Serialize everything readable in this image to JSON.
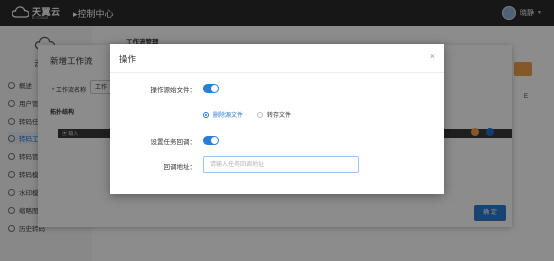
{
  "topbar": {
    "brand": "天翼云",
    "brand_sub": "E Cloud",
    "title": "▸控制中心",
    "user": "晓静"
  },
  "sidebar": {
    "logo_label": "云",
    "items": [
      {
        "label": "概述"
      },
      {
        "label": "用户管"
      },
      {
        "label": "转码任"
      },
      {
        "label": "转码工"
      },
      {
        "label": "转码管"
      },
      {
        "label": "转码模"
      },
      {
        "label": "水印模"
      },
      {
        "label": "缩略图"
      },
      {
        "label": "历史转码"
      }
    ]
  },
  "main": {
    "header": "工作流管理",
    "side_text": "E"
  },
  "bg_dialog": {
    "title": "新增工作流",
    "name_label": "* 工作流名称",
    "name_value": "工作",
    "section": "拓扑结构",
    "bar_text": "▣ 输入",
    "ok": "确 定"
  },
  "dialog": {
    "title": "操作",
    "close": "×",
    "delete_source_label": "操作源始文件：",
    "delete_source_on": true,
    "radio_options": [
      {
        "label": "删除源文件",
        "checked": true
      },
      {
        "label": "转存文件",
        "checked": false
      }
    ],
    "callback_label": "设置任务回调：",
    "callback_on": true,
    "callback_url_label": "回调地址：",
    "callback_url_placeholder": "请输入任务回调地址",
    "callback_url_value": ""
  },
  "colors": {
    "accent": "#2d7dd2",
    "topbar": "#2b2b2b",
    "orange": "#f0a04b"
  }
}
